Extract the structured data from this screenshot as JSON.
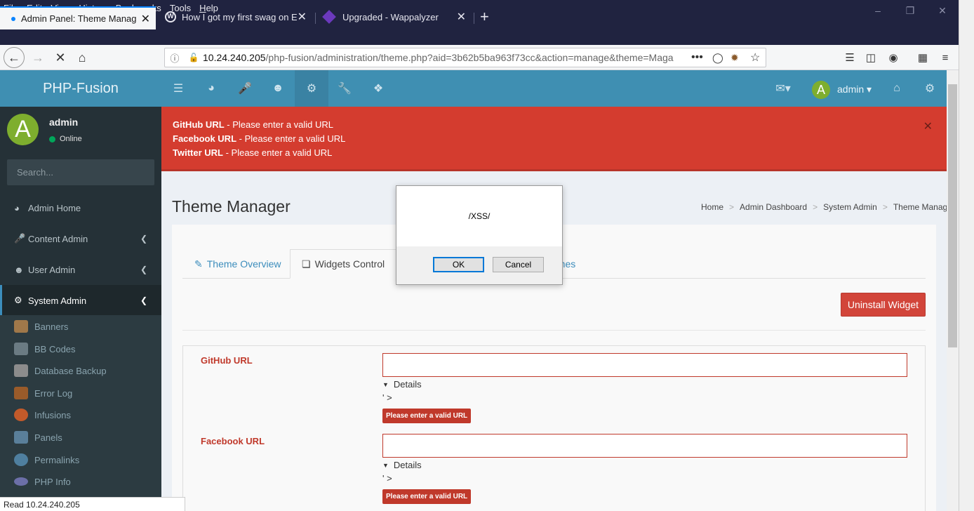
{
  "menubar": {
    "items": [
      {
        "u": "F",
        "rest": "ile"
      },
      {
        "u": "E",
        "rest": "dit"
      },
      {
        "u": "V",
        "rest": "iew"
      },
      {
        "pre": "Hi",
        "u": "s",
        "rest": "tory"
      },
      {
        "u": "B",
        "rest": "ookmarks"
      },
      {
        "u": "T",
        "rest": "ools"
      },
      {
        "u": "H",
        "rest": "elp"
      }
    ]
  },
  "tabs": [
    {
      "label": "Admin Panel: Theme Manager",
      "active": true
    },
    {
      "label": "How I got my first swag on Edmodo"
    },
    {
      "label": "Upgraded - Wappalyzer"
    }
  ],
  "url": {
    "host": "10.24.240.205",
    "path": "/php-fusion/administration/theme.php?aid=3b62b5ba963f73cc&action=manage&theme=Maga"
  },
  "header": {
    "brand": "PHP-Fusion",
    "user_label": "admin",
    "avatar_letter": "A"
  },
  "sidebar": {
    "username": "admin",
    "status": "Online",
    "avatar_letter": "A",
    "search_placeholder": "Search...",
    "items": [
      "Admin Home",
      "Content Admin",
      "User Admin",
      "System Admin"
    ],
    "subitems": [
      "Banners",
      "BB Codes",
      "Database Backup",
      "Error Log",
      "Infusions",
      "Panels",
      "Permalinks",
      "PHP Info"
    ]
  },
  "alert": {
    "lines": [
      {
        "field": "GitHub URL",
        "msg": " - Please enter a valid URL"
      },
      {
        "field": "Facebook URL",
        "msg": " - Please enter a valid URL"
      },
      {
        "field": "Twitter URL",
        "msg": " - Please enter a valid URL"
      }
    ]
  },
  "page": {
    "title": "Theme Manager",
    "breadcrumbs": [
      "Home",
      "Admin Dashboard",
      "System Admin",
      "Theme Manager"
    ],
    "tabs": [
      "Theme Overview",
      "Widgets Control",
      "emes"
    ],
    "uninstall_label": "Uninstall Widget"
  },
  "fields": [
    {
      "label": "GitHub URL",
      "details": "Details",
      "raw": "' >",
      "error": "Please enter a valid URL"
    },
    {
      "label": "Facebook URL",
      "details": "Details",
      "raw": "' >",
      "error": "Please enter a valid URL"
    }
  ],
  "dialog": {
    "message": "/XSS/",
    "ok": "OK",
    "cancel": "Cancel"
  },
  "statusbar": {
    "text": "Read 10.24.240.205"
  }
}
